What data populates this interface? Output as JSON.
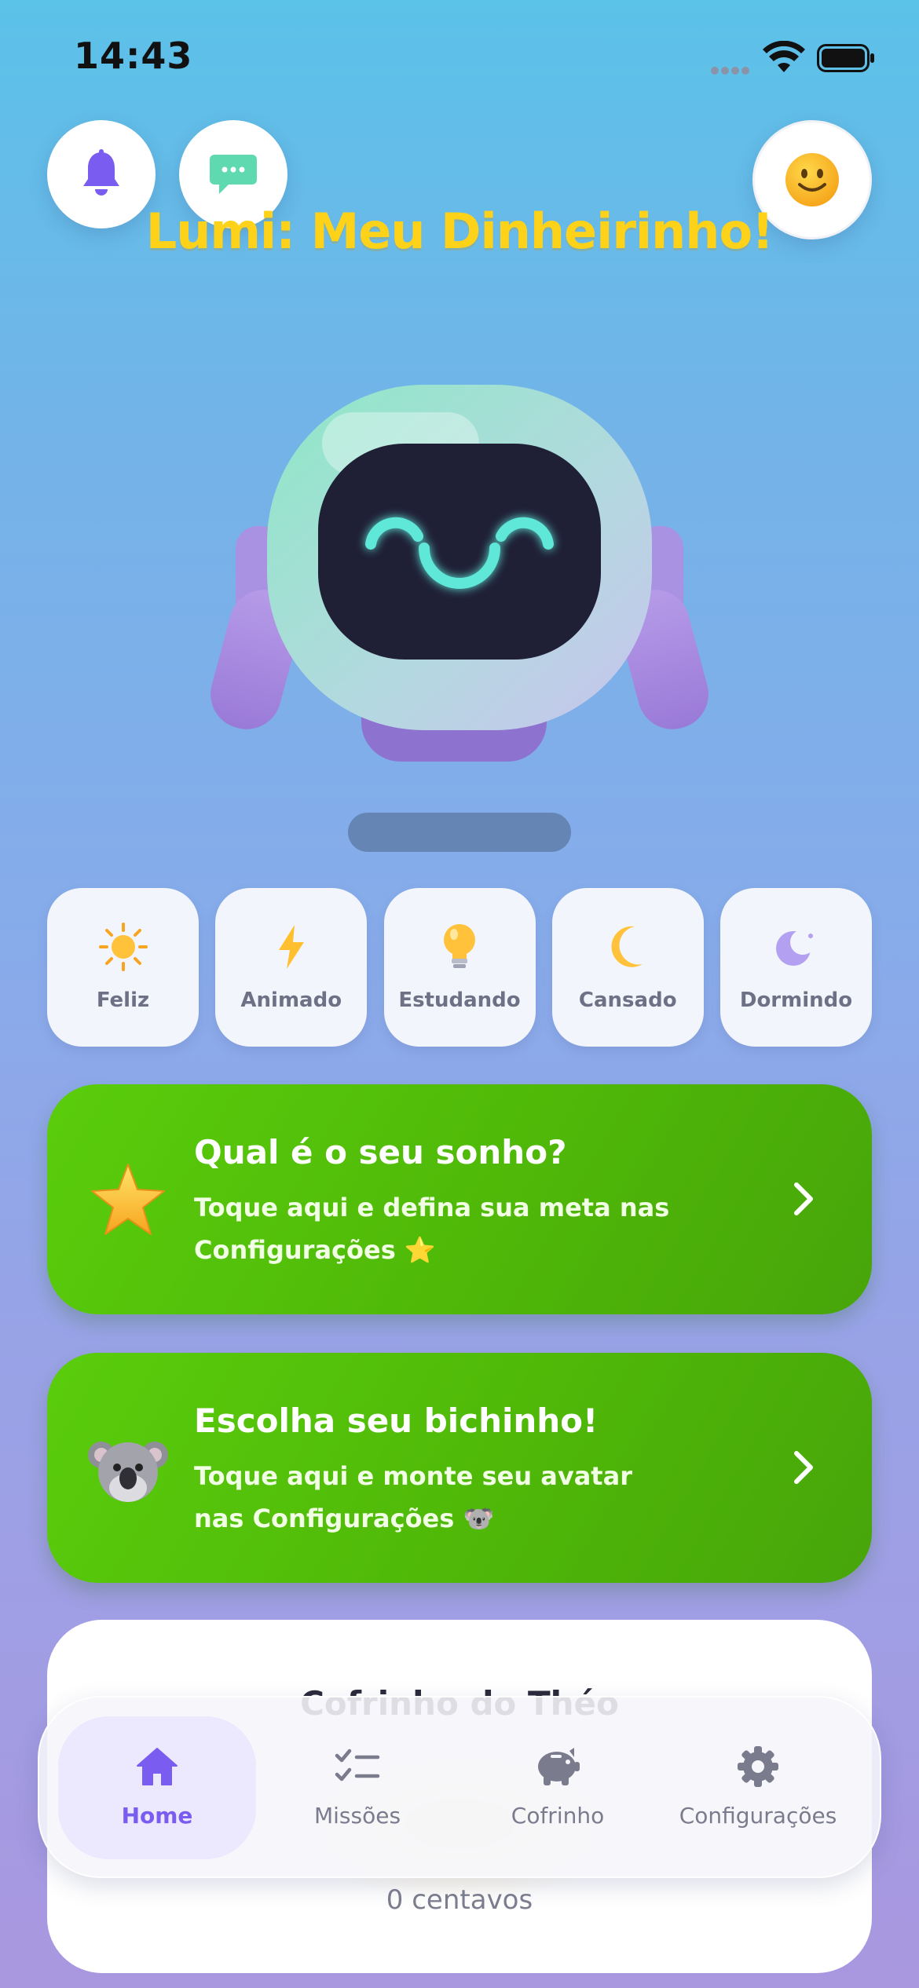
{
  "status_bar": {
    "time": "14:43"
  },
  "header": {
    "title": "Lumi: Meu Dinheirinho!",
    "bell_icon": "bell-icon",
    "chat_icon": "chat-bubble-icon",
    "avatar_icon": "smiley-face-icon"
  },
  "moods": [
    {
      "label": "Feliz",
      "icon": "sun-icon"
    },
    {
      "label": "Animado",
      "icon": "lightning-icon"
    },
    {
      "label": "Estudando",
      "icon": "lightbulb-icon"
    },
    {
      "label": "Cansado",
      "icon": "crescent-moon-icon"
    },
    {
      "label": "Dormindo",
      "icon": "moon-sleep-icon"
    }
  ],
  "promo_cards": [
    {
      "title": "Qual é o seu sonho?",
      "text": "Toque aqui e defina sua meta nas Configurações ⭐",
      "emoji": "⭐"
    },
    {
      "title": "Escolha seu bichinho!",
      "text": "Toque aqui e monte seu avatar nas Configurações 🐨",
      "emoji": "🐨"
    }
  ],
  "piggy_bank": {
    "title": "Cofrinho do Théo",
    "amount": "0 centavos"
  },
  "tabs": [
    {
      "label": "Home",
      "icon": "home-icon",
      "active": true
    },
    {
      "label": "Missões",
      "icon": "checklist-icon",
      "active": false
    },
    {
      "label": "Cofrinho",
      "icon": "piggy-bank-icon",
      "active": false
    },
    {
      "label": "Configurações",
      "icon": "gear-icon",
      "active": false
    }
  ],
  "colors": {
    "accent": "#7b5cf0",
    "title_yellow": "#ffd21a",
    "promo_green": "#4fb808",
    "robot_eye": "#5ee8d8"
  }
}
